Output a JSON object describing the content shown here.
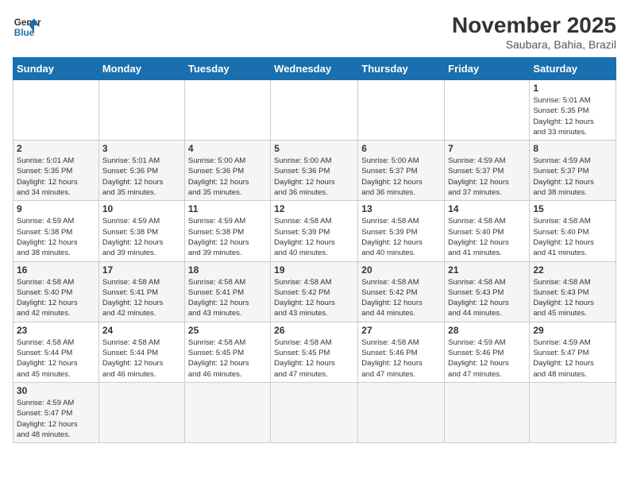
{
  "header": {
    "logo_general": "General",
    "logo_blue": "Blue",
    "month_title": "November 2025",
    "location": "Saubara, Bahia, Brazil"
  },
  "weekdays": [
    "Sunday",
    "Monday",
    "Tuesday",
    "Wednesday",
    "Thursday",
    "Friday",
    "Saturday"
  ],
  "weeks": [
    [
      {
        "day": "",
        "info": ""
      },
      {
        "day": "",
        "info": ""
      },
      {
        "day": "",
        "info": ""
      },
      {
        "day": "",
        "info": ""
      },
      {
        "day": "",
        "info": ""
      },
      {
        "day": "",
        "info": ""
      },
      {
        "day": "1",
        "info": "Sunrise: 5:01 AM\nSunset: 5:35 PM\nDaylight: 12 hours\nand 33 minutes."
      }
    ],
    [
      {
        "day": "2",
        "info": "Sunrise: 5:01 AM\nSunset: 5:35 PM\nDaylight: 12 hours\nand 34 minutes."
      },
      {
        "day": "3",
        "info": "Sunrise: 5:01 AM\nSunset: 5:36 PM\nDaylight: 12 hours\nand 35 minutes."
      },
      {
        "day": "4",
        "info": "Sunrise: 5:00 AM\nSunset: 5:36 PM\nDaylight: 12 hours\nand 35 minutes."
      },
      {
        "day": "5",
        "info": "Sunrise: 5:00 AM\nSunset: 5:36 PM\nDaylight: 12 hours\nand 36 minutes."
      },
      {
        "day": "6",
        "info": "Sunrise: 5:00 AM\nSunset: 5:37 PM\nDaylight: 12 hours\nand 36 minutes."
      },
      {
        "day": "7",
        "info": "Sunrise: 4:59 AM\nSunset: 5:37 PM\nDaylight: 12 hours\nand 37 minutes."
      },
      {
        "day": "8",
        "info": "Sunrise: 4:59 AM\nSunset: 5:37 PM\nDaylight: 12 hours\nand 38 minutes."
      }
    ],
    [
      {
        "day": "9",
        "info": "Sunrise: 4:59 AM\nSunset: 5:38 PM\nDaylight: 12 hours\nand 38 minutes."
      },
      {
        "day": "10",
        "info": "Sunrise: 4:59 AM\nSunset: 5:38 PM\nDaylight: 12 hours\nand 39 minutes."
      },
      {
        "day": "11",
        "info": "Sunrise: 4:59 AM\nSunset: 5:38 PM\nDaylight: 12 hours\nand 39 minutes."
      },
      {
        "day": "12",
        "info": "Sunrise: 4:58 AM\nSunset: 5:39 PM\nDaylight: 12 hours\nand 40 minutes."
      },
      {
        "day": "13",
        "info": "Sunrise: 4:58 AM\nSunset: 5:39 PM\nDaylight: 12 hours\nand 40 minutes."
      },
      {
        "day": "14",
        "info": "Sunrise: 4:58 AM\nSunset: 5:40 PM\nDaylight: 12 hours\nand 41 minutes."
      },
      {
        "day": "15",
        "info": "Sunrise: 4:58 AM\nSunset: 5:40 PM\nDaylight: 12 hours\nand 41 minutes."
      }
    ],
    [
      {
        "day": "16",
        "info": "Sunrise: 4:58 AM\nSunset: 5:40 PM\nDaylight: 12 hours\nand 42 minutes."
      },
      {
        "day": "17",
        "info": "Sunrise: 4:58 AM\nSunset: 5:41 PM\nDaylight: 12 hours\nand 42 minutes."
      },
      {
        "day": "18",
        "info": "Sunrise: 4:58 AM\nSunset: 5:41 PM\nDaylight: 12 hours\nand 43 minutes."
      },
      {
        "day": "19",
        "info": "Sunrise: 4:58 AM\nSunset: 5:42 PM\nDaylight: 12 hours\nand 43 minutes."
      },
      {
        "day": "20",
        "info": "Sunrise: 4:58 AM\nSunset: 5:42 PM\nDaylight: 12 hours\nand 44 minutes."
      },
      {
        "day": "21",
        "info": "Sunrise: 4:58 AM\nSunset: 5:43 PM\nDaylight: 12 hours\nand 44 minutes."
      },
      {
        "day": "22",
        "info": "Sunrise: 4:58 AM\nSunset: 5:43 PM\nDaylight: 12 hours\nand 45 minutes."
      }
    ],
    [
      {
        "day": "23",
        "info": "Sunrise: 4:58 AM\nSunset: 5:44 PM\nDaylight: 12 hours\nand 45 minutes."
      },
      {
        "day": "24",
        "info": "Sunrise: 4:58 AM\nSunset: 5:44 PM\nDaylight: 12 hours\nand 46 minutes."
      },
      {
        "day": "25",
        "info": "Sunrise: 4:58 AM\nSunset: 5:45 PM\nDaylight: 12 hours\nand 46 minutes."
      },
      {
        "day": "26",
        "info": "Sunrise: 4:58 AM\nSunset: 5:45 PM\nDaylight: 12 hours\nand 47 minutes."
      },
      {
        "day": "27",
        "info": "Sunrise: 4:58 AM\nSunset: 5:46 PM\nDaylight: 12 hours\nand 47 minutes."
      },
      {
        "day": "28",
        "info": "Sunrise: 4:59 AM\nSunset: 5:46 PM\nDaylight: 12 hours\nand 47 minutes."
      },
      {
        "day": "29",
        "info": "Sunrise: 4:59 AM\nSunset: 5:47 PM\nDaylight: 12 hours\nand 48 minutes."
      }
    ],
    [
      {
        "day": "30",
        "info": "Sunrise: 4:59 AM\nSunset: 5:47 PM\nDaylight: 12 hours\nand 48 minutes."
      },
      {
        "day": "",
        "info": ""
      },
      {
        "day": "",
        "info": ""
      },
      {
        "day": "",
        "info": ""
      },
      {
        "day": "",
        "info": ""
      },
      {
        "day": "",
        "info": ""
      },
      {
        "day": "",
        "info": ""
      }
    ]
  ]
}
